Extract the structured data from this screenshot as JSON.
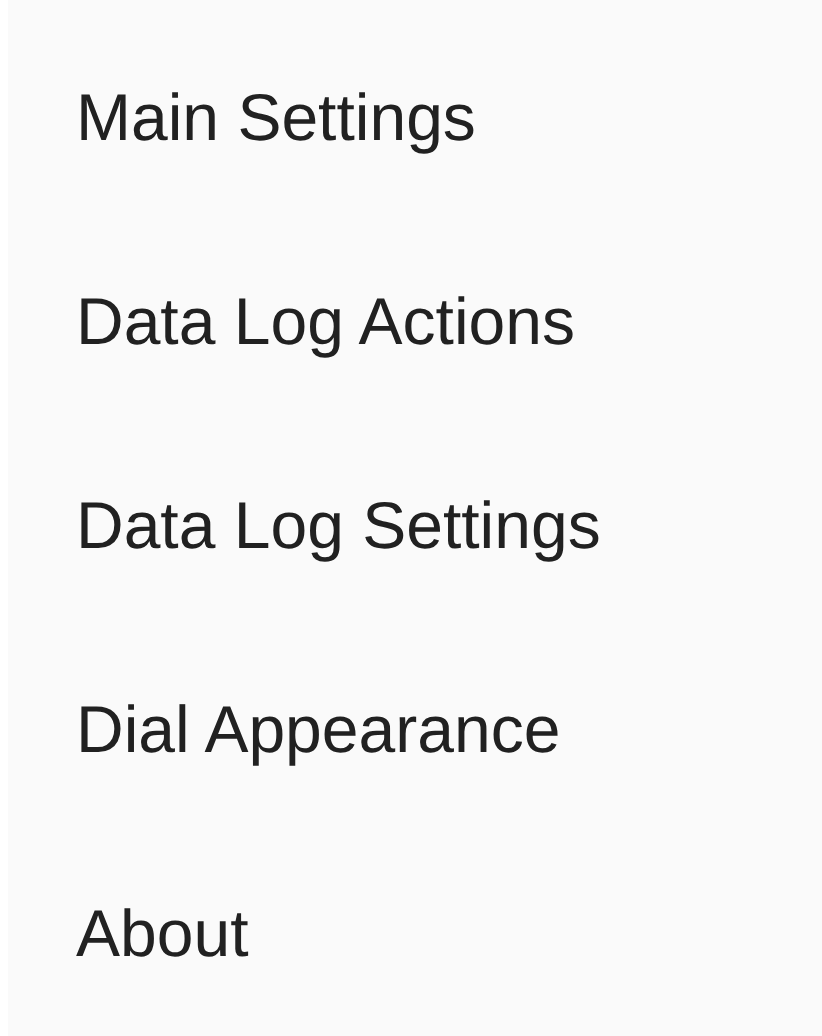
{
  "menu": {
    "items": [
      {
        "label": "Main Settings"
      },
      {
        "label": "Data Log Actions"
      },
      {
        "label": "Data Log Settings"
      },
      {
        "label": "Dial Appearance"
      },
      {
        "label": "About"
      }
    ]
  }
}
